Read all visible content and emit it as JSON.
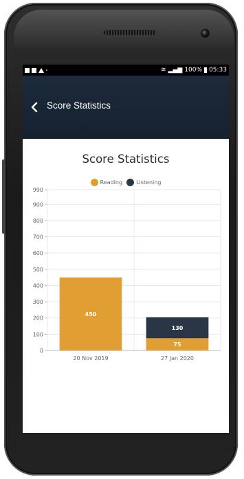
{
  "status_bar": {
    "right_text": "100%",
    "time": "05:33"
  },
  "app_bar": {
    "title": "Score Statistics"
  },
  "chart_data": {
    "type": "bar",
    "stacked": true,
    "title": "Score Statistics",
    "categories": [
      "20 Nov 2019",
      "27 Jan 2020"
    ],
    "series": [
      {
        "name": "Reading",
        "color": "#e19e33",
        "values": [
          450,
          75
        ]
      },
      {
        "name": "Listening",
        "color": "#2a3545",
        "values": [
          0,
          130
        ]
      }
    ],
    "yticks": [
      0,
      100,
      200,
      300,
      400,
      500,
      600,
      700,
      800,
      900,
      990
    ],
    "ylim": [
      0,
      990
    ],
    "grid": true,
    "legend": "top"
  }
}
